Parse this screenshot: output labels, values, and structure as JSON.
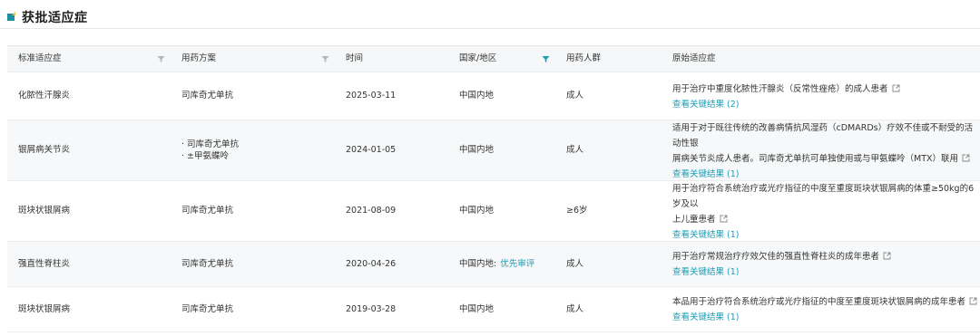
{
  "section": {
    "title": "获批适应症"
  },
  "table": {
    "headers": {
      "indication": "标准适应症",
      "regimen": "用药方案",
      "time": "时间",
      "region": "国家/地区",
      "population": "用药人群",
      "original": "原始适应症"
    },
    "rows": [
      {
        "indication": "化脓性汗腺炎",
        "regimen": [
          "司库奇尤单抗"
        ],
        "time": "2025-03-11",
        "region": "中国内地",
        "region_tag": "",
        "population": "成人",
        "original_lines": [
          "用于治疗中重度化脓性汗腺炎（反常性痤疮）的成人患者"
        ],
        "link": "查看关键结果 (2)"
      },
      {
        "indication": "银屑病关节炎",
        "regimen": [
          "司库奇尤单抗",
          "±甲氨蝶呤"
        ],
        "time": "2024-01-05",
        "region": "中国内地",
        "region_tag": "",
        "population": "成人",
        "original_lines": [
          "适用于对于既往传统的改善病情抗风湿药（cDMARDs）疗效不佳或不耐受的活动性银",
          "屑病关节炎成人患者。司库奇尤单抗可单独使用或与甲氨蝶呤（MTX）联用"
        ],
        "link": "查看关键结果 (1)"
      },
      {
        "indication": "斑块状银屑病",
        "regimen": [
          "司库奇尤单抗"
        ],
        "time": "2021-08-09",
        "region": "中国内地",
        "region_tag": "",
        "population": "≥6岁",
        "original_lines": [
          "用于治疗符合系统治疗或光疗指征的中度至重度斑块状银屑病的体重≥50kg的6岁及以",
          "上儿童患者"
        ],
        "link": "查看关键结果 (1)"
      },
      {
        "indication": "强直性脊柱炎",
        "regimen": [
          "司库奇尤单抗"
        ],
        "time": "2020-04-26",
        "region": "中国内地:",
        "region_tag": "优先审评",
        "population": "成人",
        "original_lines": [
          "用于治疗常规治疗疗效欠佳的强直性脊柱炎的成年患者"
        ],
        "link": "查看关键结果 (1)"
      },
      {
        "indication": "斑块状银屑病",
        "regimen": [
          "司库奇尤单抗"
        ],
        "time": "2019-03-28",
        "region": "中国内地",
        "region_tag": "",
        "population": "成人",
        "original_lines": [
          "本品用于治疗符合系统治疗或光疗指征的中度至重度斑块状银屑病的成年患者"
        ],
        "link": "查看关键结果 (1)"
      }
    ]
  },
  "icons": {
    "filter": "filter-icon",
    "filter_active_color": "#1a9fb8",
    "filter_color": "#b5b5b5",
    "external_link": "external-link-icon"
  }
}
